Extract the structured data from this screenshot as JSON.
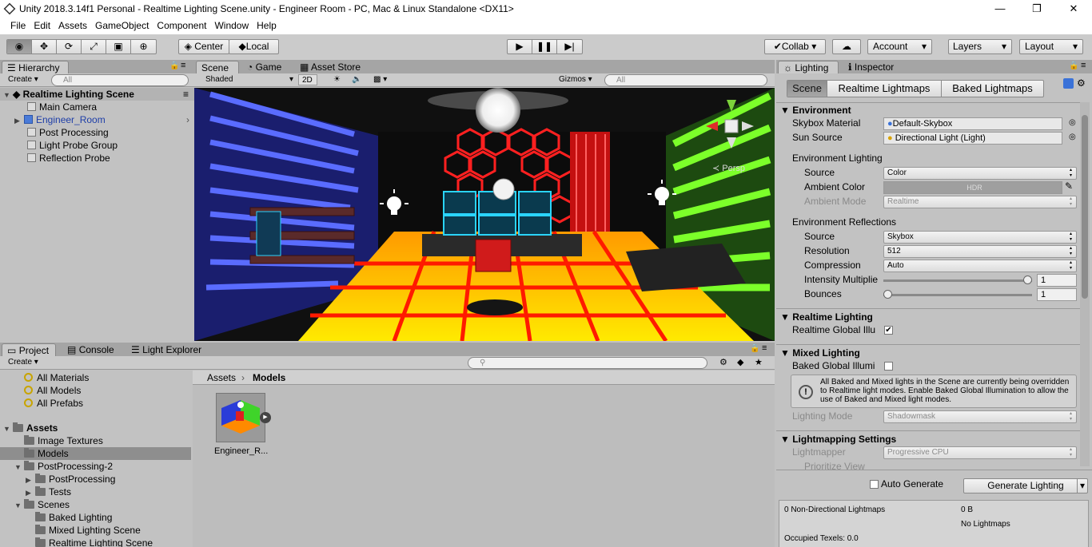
{
  "window": {
    "title": "Unity 2018.3.14f1 Personal - Realtime Lighting Scene.unity - Engineer Room - PC, Mac & Linux Standalone <DX11>",
    "minimize": "—",
    "maximize": "❐",
    "close": "✕"
  },
  "menu": [
    "File",
    "Edit",
    "Assets",
    "GameObject",
    "Component",
    "Window",
    "Help"
  ],
  "toolbar": {
    "center": "Center",
    "local": "Local",
    "collab": "Collab",
    "account": "Account",
    "layers": "Layers",
    "layout": "Layout"
  },
  "hierarchy": {
    "tab": "Hierarchy",
    "create": "Create",
    "search_placeholder": "All",
    "scene": "Realtime Lighting Scene",
    "items": [
      "Main Camera",
      "Engineer_Room",
      "Post Processing",
      "Light Probe Group",
      "Reflection Probe"
    ]
  },
  "scene_tabs": {
    "scene": "Scene",
    "game": "Game",
    "asset_store": "Asset Store",
    "shading": "Shaded",
    "mode2d": "2D",
    "gizmos": "Gizmos",
    "search_placeholder": "All",
    "persp": "Persp"
  },
  "project": {
    "tabs": [
      "Project",
      "Console",
      "Light Explorer"
    ],
    "create": "Create",
    "favorites": [
      "All Materials",
      "All Models",
      "All Prefabs"
    ],
    "assets_root": "Assets",
    "tree": [
      "Image Textures",
      "Models",
      "PostProcessing-2",
      "PostProcessing",
      "Tests",
      "Scenes",
      "Baked Lighting",
      "Mixed Lighting Scene",
      "Realtime Lighting Scene"
    ],
    "breadcrumb": [
      "Assets",
      "Models"
    ],
    "asset_name": "Engineer_R..."
  },
  "lighting": {
    "tab": "Lighting",
    "inspector_tab": "Inspector",
    "subtabs": [
      "Scene",
      "Realtime Lightmaps",
      "Baked Lightmaps"
    ],
    "environment": "Environment",
    "skybox_label": "Skybox Material",
    "skybox_value": "Default-Skybox",
    "sun_label": "Sun Source",
    "sun_value": "Directional Light (Light)",
    "env_lighting": "Environment Lighting",
    "source_label": "Source",
    "source_value": "Color",
    "ambient_color_label": "Ambient Color",
    "ambient_color_value": "HDR",
    "ambient_mode_label": "Ambient Mode",
    "ambient_mode_value": "Realtime",
    "env_reflections": "Environment Reflections",
    "refl_source_value": "Skybox",
    "resolution_label": "Resolution",
    "resolution_value": "512",
    "compression_label": "Compression",
    "compression_value": "Auto",
    "intensity_label": "Intensity Multiplie",
    "intensity_value": "1",
    "intensity_fraction": 1.0,
    "bounces_label": "Bounces",
    "bounces_value": "1",
    "bounces_fraction": 0.0,
    "realtime_header": "Realtime Lighting",
    "realtime_gi_label": "Realtime Global Illu",
    "realtime_gi_checked": true,
    "mixed_header": "Mixed Lighting",
    "baked_gi_label": "Baked Global Illumi",
    "baked_gi_checked": false,
    "info_text": "All Baked and Mixed lights in the Scene are currently being overridden to Realtime light modes. Enable Baked Global Illumination to allow the use of Baked and Mixed light modes.",
    "lighting_mode_label": "Lighting Mode",
    "lighting_mode_value": "Shadowmask",
    "lightmapping_header": "Lightmapping Settings",
    "lightmapper_label": "Lightmapper",
    "lightmapper_value": "Progressive CPU",
    "prioritize_label": "Prioritize View",
    "auto_generate": "Auto Generate",
    "generate_button": "Generate Lighting",
    "stats_lightmaps": "0 Non-Directional Lightmaps",
    "stats_size": "0 B",
    "stats_none": "No Lightmaps",
    "stats_texels": "Occupied Texels: 0.0"
  },
  "colors": {
    "accent": "#3a72d8",
    "panel": "#c2c2c2",
    "toolbar": "#cbcbcb",
    "selection": "#8e8e8e"
  }
}
